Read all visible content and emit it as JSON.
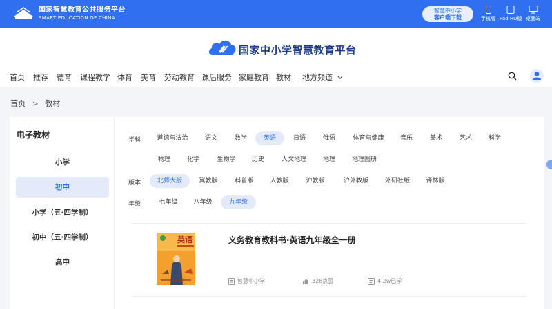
{
  "topbar": {
    "brand_cn": "国家智慧教育公共服务平台",
    "brand_en": "SMART EDUCATION OF CHINA",
    "client_line1": "智慧中小学",
    "client_line2": "客户端下载",
    "devices": [
      {
        "label": "手机版",
        "icon": "phone-icon"
      },
      {
        "label": "Pad HD版",
        "icon": "tablet-icon"
      },
      {
        "label": "桌面端",
        "icon": "desktop-icon"
      }
    ]
  },
  "header": {
    "site_title": "国家中小学智慧教育平台",
    "nav": [
      "首页",
      "推荐",
      "德育",
      "课程教学",
      "体育",
      "美育",
      "劳动教育",
      "课后服务",
      "家庭教育",
      "教材",
      "地方频道"
    ]
  },
  "breadcrumb": {
    "home": "首页",
    "separator": ">",
    "current": "教材"
  },
  "sidebar": {
    "title": "电子教材",
    "items": [
      "小学",
      "初中",
      "小学（五·四学制）",
      "初中（五·四学制）",
      "高中"
    ],
    "active_index": 1
  },
  "filters": {
    "subject_label": "学科",
    "subjects": [
      "道德与法治",
      "语文",
      "数学",
      "英语",
      "日语",
      "俄语",
      "体育与健康",
      "音乐",
      "美术",
      "艺术",
      "科学",
      "物理",
      "化学",
      "生物学",
      "历史",
      "人文地理",
      "地理",
      "地理图册"
    ],
    "subject_active": "英语",
    "edition_label": "版本",
    "editions": [
      "北师大版",
      "冀教版",
      "科普版",
      "人教版",
      "沪教版",
      "沪外教版",
      "外研社版",
      "译林版"
    ],
    "edition_active": "北师大版",
    "grade_label": "年级",
    "grades": [
      "七年级",
      "八年级",
      "九年级"
    ],
    "grade_active": "九年级"
  },
  "book": {
    "title": "义务教育教科书·英语九年级全一册",
    "cover_text": "英语",
    "source": "智慧中小学",
    "likes": "328点赞",
    "learners": "4.2w已学"
  },
  "colors": {
    "primary": "#2f6ff0",
    "active_bg": "#e3ebfb",
    "cover": "#f3a02e"
  }
}
